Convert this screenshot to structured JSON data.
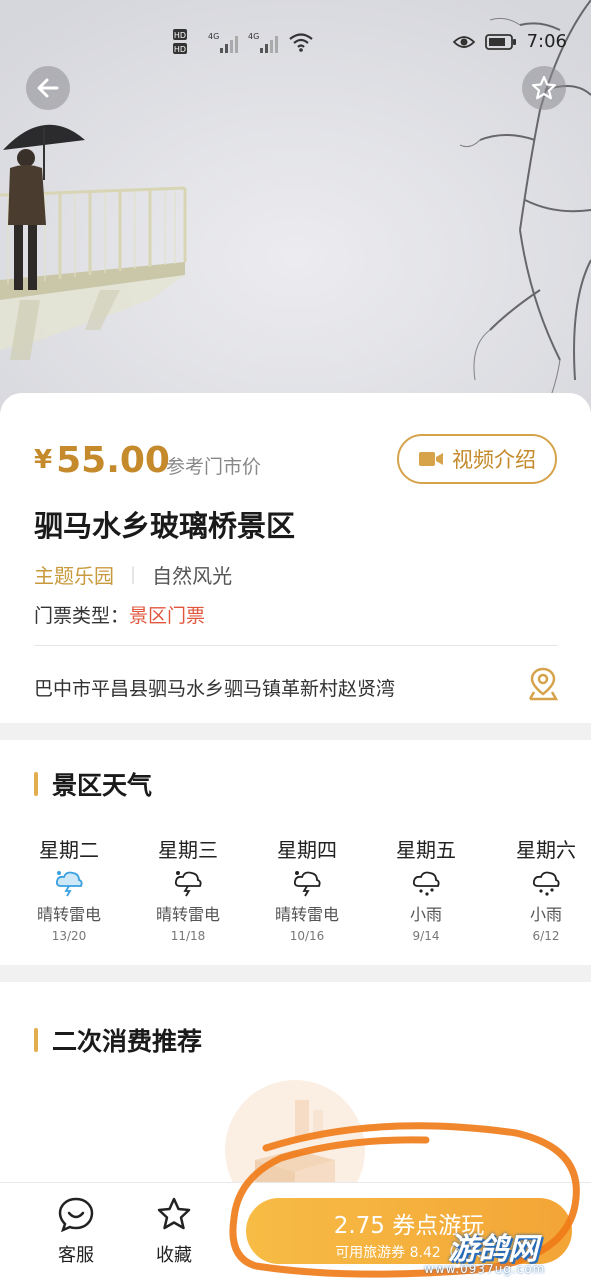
{
  "status_bar": {
    "signal_labels": [
      "HD",
      "HD",
      "4G",
      "4G"
    ],
    "time": "7:06"
  },
  "header": {
    "back_icon": "arrow-left-icon",
    "favorite_icon": "star-icon"
  },
  "ticket": {
    "currency": "¥",
    "price": "55.00",
    "reference_label": "参考门市价",
    "video_button": "视频介绍",
    "name": "驷马水乡玻璃桥景区",
    "tags": [
      "主题乐园",
      "自然风光"
    ],
    "type_label": "门票类型：",
    "type_value": "景区门票",
    "address": "巴中市平昌县驷马水乡驷马镇革新村赵贤湾"
  },
  "weather": {
    "title": "景区天气",
    "days": [
      {
        "name": "星期二",
        "desc": "晴转雷电",
        "temp": "13/20",
        "icon": "thunder-cloud-icon"
      },
      {
        "name": "星期三",
        "desc": "晴转雷电",
        "temp": "11/18",
        "icon": "thunder-cloud-icon"
      },
      {
        "name": "星期四",
        "desc": "晴转雷电",
        "temp": "10/16",
        "icon": "thunder-cloud-icon"
      },
      {
        "name": "星期五",
        "desc": "小雨",
        "temp": "9/14",
        "icon": "rain-cloud-icon"
      },
      {
        "name": "星期六",
        "desc": "小雨",
        "temp": "6/12",
        "icon": "rain-cloud-icon"
      }
    ]
  },
  "recommend": {
    "title": "二次消费推荐"
  },
  "bottom_bar": {
    "service_label": "客服",
    "favorite_label": "收藏",
    "cta_main": "2.75 券点游玩",
    "cta_sub": "可用旅游券 8.42（每天"
  },
  "watermark": {
    "text": "游鸽网",
    "url": "www.0937ug.com"
  },
  "colors": {
    "accent": "#c48a2c",
    "cta": "#f5b03d",
    "ticket_type": "#e0573e",
    "scribble": "#f07a16"
  }
}
